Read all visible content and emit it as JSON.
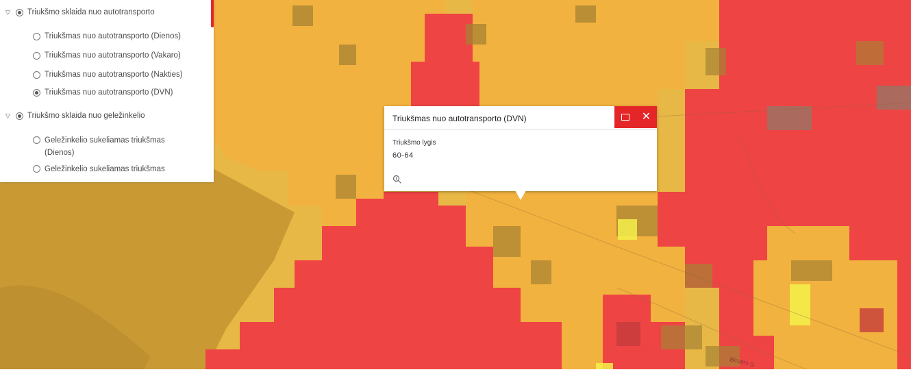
{
  "colors": {
    "map_background": "#e8b846",
    "noise_red": "#ef4444",
    "noise_orange": "#f2b23f",
    "noise_dark": "#a68233",
    "noise_yellow": "#f4f04a",
    "river": "#c99a34",
    "accent": "#e52629"
  },
  "layer_list": {
    "items": [
      {
        "label": "Triukšmo sklaida nuo autotransporto",
        "type": "group",
        "checked": true
      },
      {
        "label": "Triukšmas nuo autotransporto (Dienos)",
        "type": "radio",
        "checked": false
      },
      {
        "label": "Triukšmas nuo autotransporto (Vakaro)",
        "type": "radio",
        "checked": false
      },
      {
        "label": "Triukšmas nuo autotransporto (Nakties)",
        "type": "radio",
        "checked": false
      },
      {
        "label": "Triukšmas nuo autotransporto (DVN)",
        "type": "radio",
        "checked": true
      },
      {
        "label": "Triukšmo sklaida nuo geležinkelio",
        "type": "group",
        "checked": true
      },
      {
        "label": "Geležinkelio sukeliamas triukšmas (Dienos)",
        "type": "radio",
        "checked": false
      },
      {
        "label": "Geležinkelio sukeliamas triukšmas",
        "type": "radio",
        "checked": false
      }
    ]
  },
  "popup": {
    "title": "Triukšmas nuo autotransporto (DVN)",
    "field_label": "Triukšmo lygis",
    "field_value": "60-64",
    "buttons": [
      "maximize-icon",
      "close-icon"
    ]
  },
  "map": {
    "street_label": "Birutės g."
  }
}
